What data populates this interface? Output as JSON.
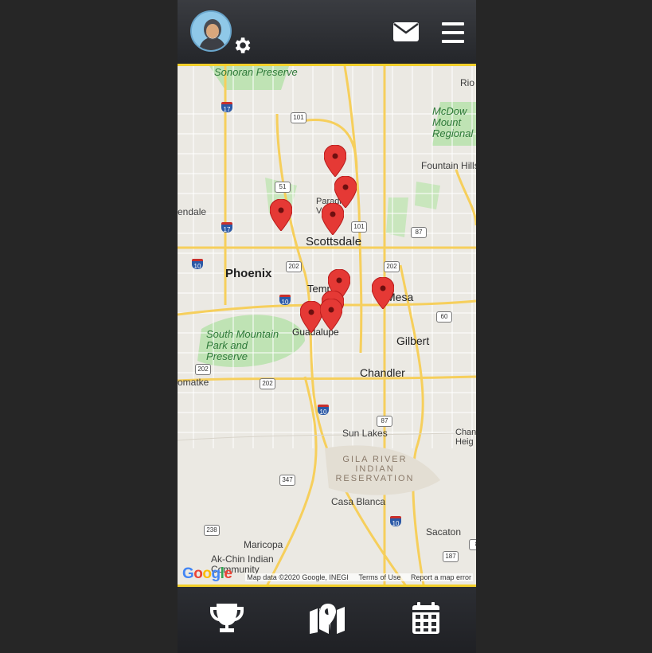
{
  "header": {
    "avatar_icon": "user-avatar",
    "settings_icon": "gear-icon",
    "messages_icon": "envelope-icon",
    "menu_icon": "hamburger-menu-icon"
  },
  "map": {
    "places": {
      "phoenix": "Phoenix",
      "scottsdale": "Scottsdale",
      "tempe": "Tempe",
      "mesa": "Mesa",
      "gilbert": "Gilbert",
      "chandler": "Chandler",
      "glendale": "endale",
      "paradise_valley": "Paradi Valle",
      "guadalupe": "Guadalupe",
      "sun_lakes": "Sun Lakes",
      "casa_blanca": "Casa Blanca",
      "sacaton": "Sacaton",
      "maricopa": "Maricopa",
      "ak_chin": "Ak-Chin Indian Community",
      "fountain_hills": "Fountain Hills",
      "rio": "Rio",
      "tolleson": "omatke",
      "chandler_heights": "Chan Heig"
    },
    "parks": {
      "sonoran": "Sonoran Preserve",
      "mcdowell": "McDow Mount Regional",
      "south_mountain": "South Mountain Park and Preserve"
    },
    "reservation": "GILA RIVER INDIAN RESERVATION",
    "route_shields": [
      "17",
      "101",
      "51",
      "17",
      "10",
      "202",
      "10",
      "101",
      "87",
      "202",
      "60",
      "202",
      "202",
      "10",
      "87",
      "347",
      "10",
      "238",
      "187",
      "8"
    ],
    "pin_count": 9,
    "attribution": {
      "brand": "Google",
      "data": "Map data ©2020 Google, INEGI",
      "terms": "Terms of Use",
      "report": "Report a map error"
    },
    "pin_color": "#e53935",
    "accent_color": "#f2cf2a"
  },
  "bottom_nav": {
    "items": [
      {
        "icon": "trophy-icon"
      },
      {
        "icon": "map-marker-icon"
      },
      {
        "icon": "calendar-icon"
      }
    ]
  }
}
